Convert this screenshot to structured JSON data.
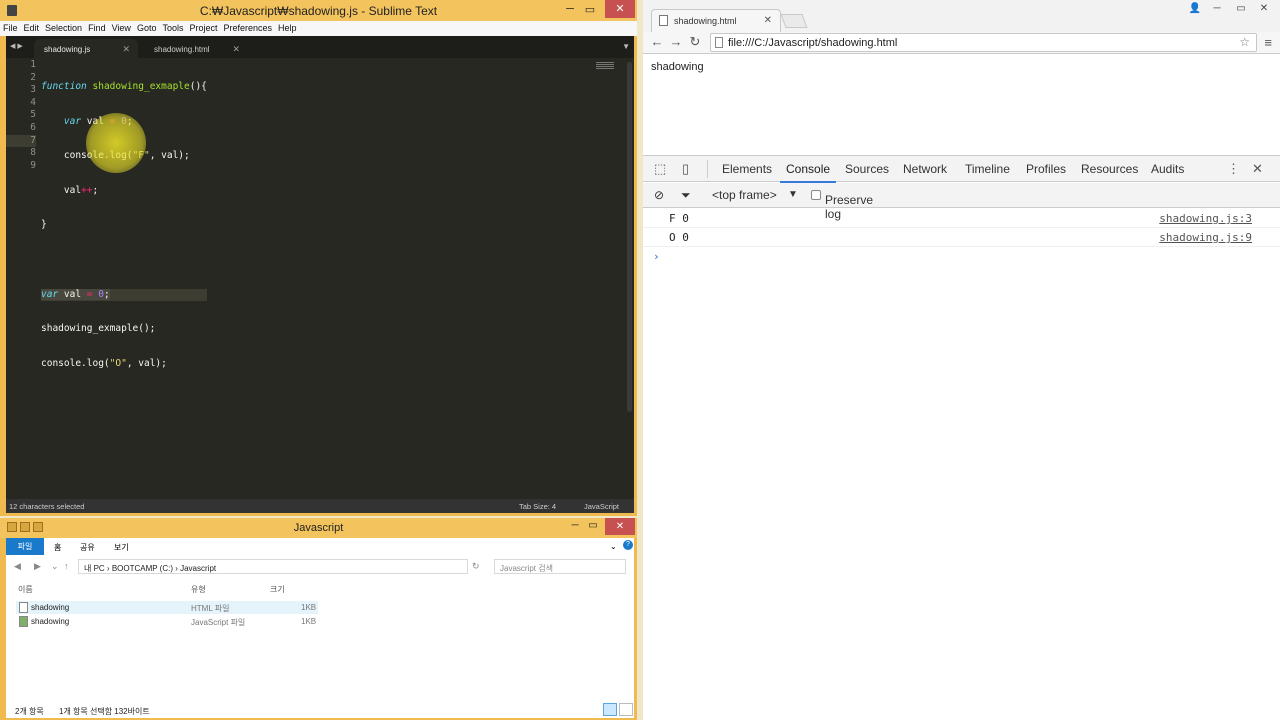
{
  "sublime": {
    "title": "C:₩Javascript₩shadowing.js - Sublime Text",
    "menu": [
      "File",
      "Edit",
      "Selection",
      "Find",
      "View",
      "Goto",
      "Tools",
      "Project",
      "Preferences",
      "Help"
    ],
    "tabs": [
      {
        "label": "shadowing.js",
        "active": true
      },
      {
        "label": "shadowing.html",
        "active": false
      }
    ],
    "line_numbers": [
      "1",
      "2",
      "3",
      "4",
      "5",
      "6",
      "7",
      "8",
      "9"
    ],
    "status": {
      "selection": "12 characters selected",
      "tab_size": "Tab Size: 4",
      "syntax": "JavaScript"
    }
  },
  "explorer": {
    "title": "Javascript",
    "ribbon": {
      "file": "파일",
      "home": "홈",
      "share": "공유",
      "view": "보기"
    },
    "breadcrumb": [
      "내 PC",
      "BOOTCAMP (C:)",
      "Javascript"
    ],
    "search_placeholder": "Javascript 검색",
    "columns": {
      "name": "이름",
      "type": "유형",
      "size": "크기"
    },
    "files": [
      {
        "name": "shadowing",
        "type": "HTML 파일",
        "size": "1KB"
      },
      {
        "name": "shadowing",
        "type": "JavaScript 파일",
        "size": "1KB"
      }
    ],
    "status": {
      "count": "2개 항목",
      "selected": "1개 항목 선택함 132바이트"
    }
  },
  "chrome": {
    "tab_title": "shadowing.html",
    "url": "file:///C:/Javascript/shadowing.html",
    "page_text": "shadowing",
    "devtools": {
      "tabs": [
        "Elements",
        "Console",
        "Sources",
        "Network",
        "Timeline",
        "Profiles",
        "Resources",
        "Audits"
      ],
      "active_tab": "Console",
      "frame": "<top frame>",
      "preserve_log": "Preserve log",
      "console": [
        {
          "msg": "F 0",
          "src": "shadowing.js:3"
        },
        {
          "msg": "O 0",
          "src": "shadowing.js:9"
        }
      ],
      "prompt": "›"
    }
  },
  "colors": {
    "editor_bg": "#272822",
    "window_frame": "#f0ba4e",
    "devtools_accent": "#3879d9"
  }
}
